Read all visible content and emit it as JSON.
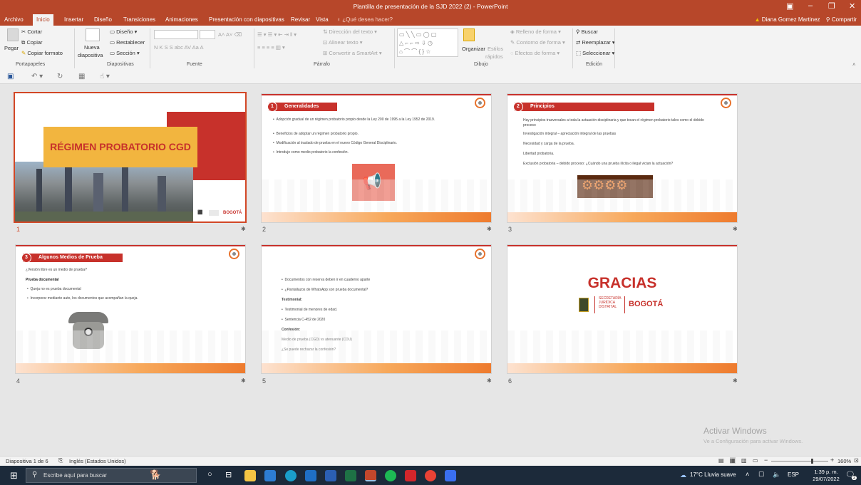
{
  "window": {
    "title": "Plantilla de presentación de la SJD 2022 (2) - PowerPoint"
  },
  "tabs": [
    "Archivo",
    "Inicio",
    "Insertar",
    "Diseño",
    "Transiciones",
    "Animaciones",
    "Presentación con diapositivas",
    "Revisar",
    "Vista"
  ],
  "tellme": "¿Qué desea hacer?",
  "user": {
    "name": "Diana Gomez Martinez",
    "share": "Compartir"
  },
  "ribbon": {
    "clipboard": {
      "paste": "Pegar",
      "cut": "Cortar",
      "copy": "Copiar",
      "format_painter": "Copiar formato",
      "group": "Portapapeles"
    },
    "slides": {
      "new_slide_1": "Nueva",
      "new_slide_2": "diapositiva",
      "layout": "Diseño",
      "reset": "Restablecer",
      "section": "Sección",
      "group": "Diapositivas"
    },
    "font": {
      "group": "Fuente",
      "row2": "N  K  S  S  abc  AV  Aa  A"
    },
    "paragraph": {
      "text_direction": "Dirección del texto",
      "align_text": "Alinear texto",
      "smartart": "Convertir a SmartArt",
      "group": "Párrafo"
    },
    "drawing": {
      "arrange": "Organizar",
      "quick_styles_1": "Estilos",
      "quick_styles_2": "rápidos",
      "fill": "Relleno de forma",
      "outline": "Contorno de forma",
      "effects": "Efectos de forma",
      "group": "Dibujo"
    },
    "editing": {
      "find": "Buscar",
      "replace": "Reemplazar",
      "select": "Seleccionar",
      "group": "Edición"
    }
  },
  "slides": [
    {
      "num": "1",
      "title": "RÉGIMEN PROBATORIO CGD",
      "footer": "BOGOTÁ"
    },
    {
      "num": "2",
      "badge": "1",
      "heading": "Generalidades",
      "bullets": [
        "Adopción gradual de un régimen probatorio propio desde la Ley 200 de 1995 a la Ley 1952 de 2019.",
        "Beneficios de adoptar un régimen probatorio propio.",
        "Modificación al traslado de prueba en el nuevo Código General Disciplinario.",
        "Introdujo como medio probatorio la confesión."
      ]
    },
    {
      "num": "3",
      "badge": "2",
      "heading": "Principios",
      "lines": [
        "Hay principios trasversales a toda la actuación disciplinaria y que tocan el régimen probatorio tales como el debido proceso",
        "Investigación integral – apreciación integral de las pruebas",
        "Necesidad y carga de la prueba.",
        "Libertad probatoria.",
        "Exclusión probatoria – debido proceso: ¿Cuándo una prueba ilícita o ilegal vician la actuación?"
      ]
    },
    {
      "num": "4",
      "badge": "3",
      "heading": "Algunos Medios de Prueba",
      "lines": [
        "¿Versión libre es un medio de prueba?",
        "Prueba documental",
        "Queja no es prueba documental",
        "Incorporar mediante auto, los documentos que acompañan la queja."
      ]
    },
    {
      "num": "5",
      "lines": [
        "Documentos con reserva deben ir en cuaderno aparte",
        "¿Pantallazos de WhatsApp son prueba documental?",
        "Testimonial:",
        "Testimonial de menores de edad.",
        "Sentencia C-452 de 2020",
        "Confesión:",
        "Medio de prueba (CGD) vs atenuante (CDU)",
        "¿Se puede rechazar la confesión?"
      ]
    },
    {
      "num": "6",
      "title": "GRACIAS",
      "org1": "SECRETARÍA",
      "org2": "JURÍDICA",
      "org3": "DISTRITAL",
      "city": "BOGOTÁ"
    }
  ],
  "watermark": {
    "line1": "Activar Windows",
    "line2": "Ve a Configuración para activar Windows."
  },
  "statusbar": {
    "slide": "Diapositiva 1 de 6",
    "lang": "Inglés (Estados Unidos)",
    "zoom": "160%"
  },
  "taskbar": {
    "search": "Escribe aquí para buscar",
    "weather": "17°C Lluvia suave",
    "lang": "ESP",
    "time": "1:39 p. m.",
    "date": "29/07/2022",
    "notif": "2"
  }
}
